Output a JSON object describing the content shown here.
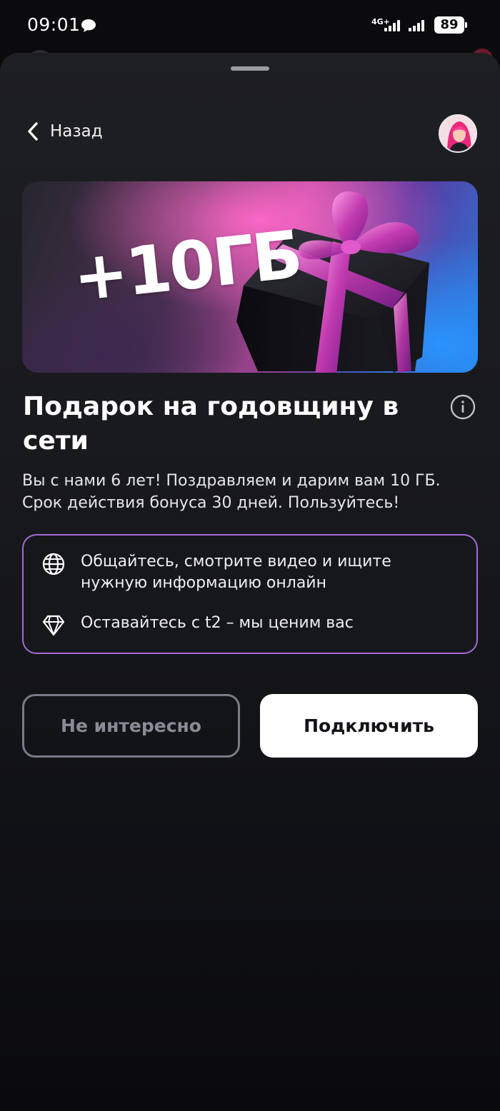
{
  "status_bar": {
    "time": "09:01",
    "network": "4G+",
    "battery": "89"
  },
  "header": {
    "back_label": "Назад"
  },
  "banner": {
    "text": "+10ГБ"
  },
  "offer": {
    "title": "Подарок на годовщину в сети",
    "description": "Вы с нами 6 лет! Поздравляем и дарим вам 10 ГБ. Срок действия бонуса 30 дней. Пользуйтесь!",
    "features": [
      {
        "icon": "globe-icon",
        "text": "Общайтесь, смотрите видео и ищите нужную информацию онлайн"
      },
      {
        "icon": "diamond-icon",
        "text": "Оставайтесь с t2 – мы ценим вас"
      }
    ]
  },
  "actions": {
    "decline_label": "Не интересно",
    "accept_label": "Подключить"
  },
  "colors": {
    "background": "#0b0b0e",
    "sheet": "#1e1f23",
    "feature_border": "#a56ad6",
    "accept_button": "#ffffff",
    "decline_border": "#7a7b86"
  }
}
